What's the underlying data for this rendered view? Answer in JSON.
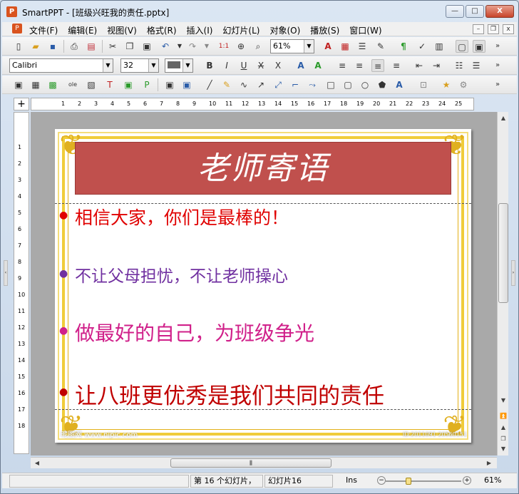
{
  "window": {
    "app_icon": "P",
    "title": "SmartPPT - [班级兴旺我的责任.pptx]",
    "btn_min": "—",
    "btn_max": "□",
    "btn_close": "X"
  },
  "menu": {
    "items": [
      "文件(F)",
      "编辑(E)",
      "视图(V)",
      "格式(R)",
      "插入(I)",
      "幻灯片(L)",
      "对象(O)",
      "播放(S)",
      "窗口(W)"
    ],
    "mdi_min": "–",
    "mdi_restore": "❐",
    "mdi_close": "x"
  },
  "toolbar1": {
    "zoom_value": "61%"
  },
  "toolbar2": {
    "font_name": "Calibri",
    "font_size": "32"
  },
  "ruler": {
    "h_ticks": [
      "1",
      "2",
      "3",
      "4",
      "5",
      "6",
      "7",
      "8",
      "9",
      "10",
      "11",
      "12",
      "13",
      "14",
      "15",
      "16",
      "17",
      "18",
      "19",
      "20",
      "21",
      "22",
      "23",
      "24",
      "25"
    ],
    "v_ticks": [
      "1",
      "2",
      "3",
      "4",
      "5",
      "6",
      "7",
      "8",
      "9",
      "10",
      "11",
      "12",
      "13",
      "14",
      "15",
      "16",
      "17",
      "18"
    ]
  },
  "slide": {
    "title": "老师寄语",
    "lines": [
      {
        "text": "相信大家，你们是最棒的！",
        "color": "#e00000"
      },
      {
        "text": "不让父母担忧，不让老师操心",
        "color": "#7030a0"
      },
      {
        "text": "做最好的自己，为班级争光",
        "color": "#d0208a"
      },
      {
        "text": "让八班更优秀是我们共同的责任",
        "color": "#c00000"
      }
    ],
    "watermark_left": "昵图网 www.nipic.com",
    "watermark_right": "ID:2011091·20560151"
  },
  "status": {
    "slide_count": "第 16 个幻灯片，",
    "current": "幻灯片16",
    "mode": "Ins",
    "zoom": "61%"
  }
}
